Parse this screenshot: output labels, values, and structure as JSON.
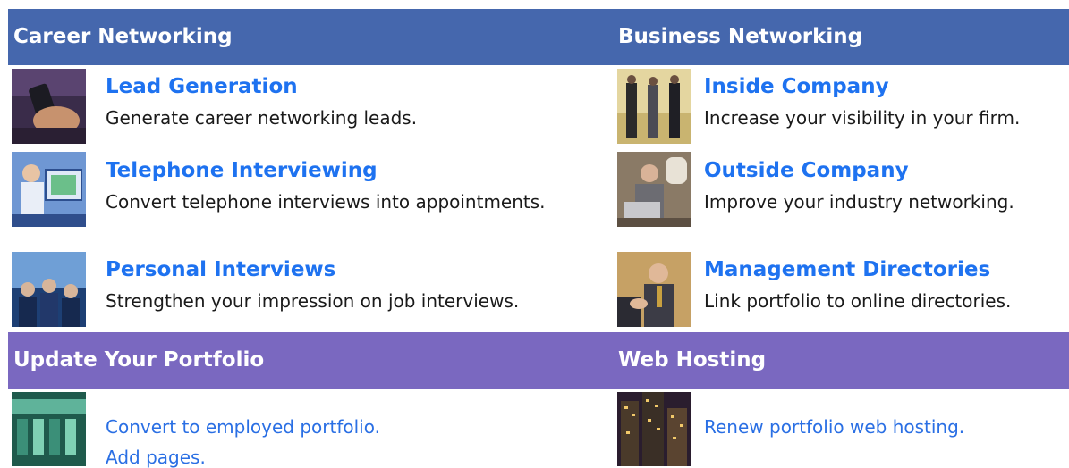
{
  "sections": {
    "career": {
      "heading": "Career Networking",
      "items": [
        {
          "title": "Lead Generation",
          "desc": "Generate career networking leads."
        },
        {
          "title": "Telephone Interviewing",
          "desc": "Convert telephone interviews into appointments."
        },
        {
          "title": "Personal Interviews",
          "desc": "Strengthen your impression on job interviews."
        }
      ]
    },
    "business": {
      "heading": "Business Networking",
      "items": [
        {
          "title": "Inside Company",
          "desc": "Increase your visibility in your firm."
        },
        {
          "title": "Outside Company",
          "desc": "Improve your industry networking."
        },
        {
          "title": "Management Directories",
          "desc": "Link portfolio to online directories."
        }
      ]
    },
    "portfolio": {
      "heading": "Update Your Portfolio",
      "links": [
        "Convert to employed portfolio.",
        "Add pages."
      ]
    },
    "hosting": {
      "heading": "Web Hosting",
      "links": [
        "Renew portfolio web hosting."
      ]
    }
  },
  "colors": {
    "bar_blue": "#4567ad",
    "bar_purple": "#7a68c0",
    "title_blue": "#1e72f0",
    "link_blue": "#2a6fe4"
  }
}
